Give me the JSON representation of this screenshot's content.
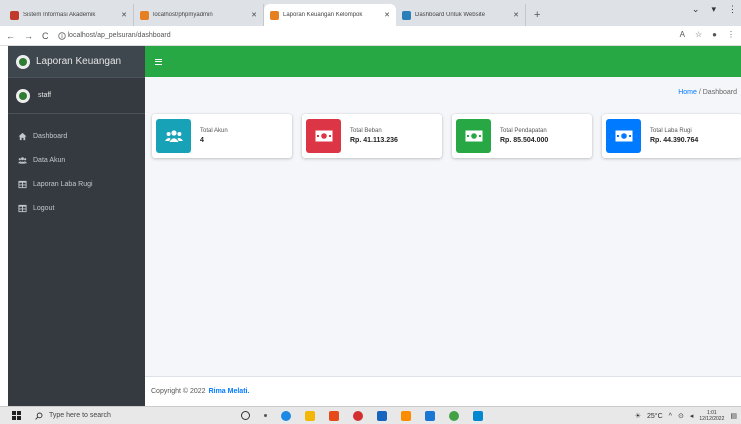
{
  "browser": {
    "tabs": [
      {
        "label": "Sistem Informasi Akademik",
        "color": "#c0392b",
        "active": false
      },
      {
        "label": "localhost/phpmyadmin",
        "color": "#e67e22",
        "active": false
      },
      {
        "label": "Laporan Keuangan Kelompok",
        "color": "#e67e22",
        "active": true
      },
      {
        "label": "Dashboard Untuk Website",
        "color": "#2980b9",
        "active": false
      }
    ],
    "url": "localhost/ap_pelsuran/dashboard"
  },
  "app": {
    "brand": "Laporan Keuangan",
    "user": "staff",
    "menu": [
      {
        "label": "Dashboard",
        "icon": "home-icon"
      },
      {
        "label": "Data Akun",
        "icon": "users-icon"
      },
      {
        "label": "Laporan Laba Rugi",
        "icon": "table-icon"
      },
      {
        "label": "Logout",
        "icon": "logout-icon"
      }
    ],
    "breadcrumb": {
      "home": "Home",
      "sep": " / ",
      "current": "Dashboard"
    },
    "cards": [
      {
        "title": "Total Akun",
        "value": "4",
        "color": "#17a2b8",
        "icon": "users-icon"
      },
      {
        "title": "Total Beban",
        "value": "Rp. 41.113.236",
        "color": "#dc3545",
        "icon": "money-icon"
      },
      {
        "title": "Total Pendapatan",
        "value": "Rp. 85.504.000",
        "color": "#28a745",
        "icon": "money-icon"
      },
      {
        "title": "Total Laba Rugi",
        "value": "Rp. 44.390.764",
        "color": "#007bff",
        "icon": "money-icon"
      }
    ],
    "footer": {
      "copyright": "Copyright © 2022",
      "author": "Rima Melati."
    }
  },
  "taskbar": {
    "search_placeholder": "Type here to search",
    "weather": "25°C",
    "time": "1:01",
    "date": "12/12/2022"
  },
  "colors": {
    "navbar": "#28a745",
    "sidebar": "#343a40",
    "link": "#007bff"
  }
}
